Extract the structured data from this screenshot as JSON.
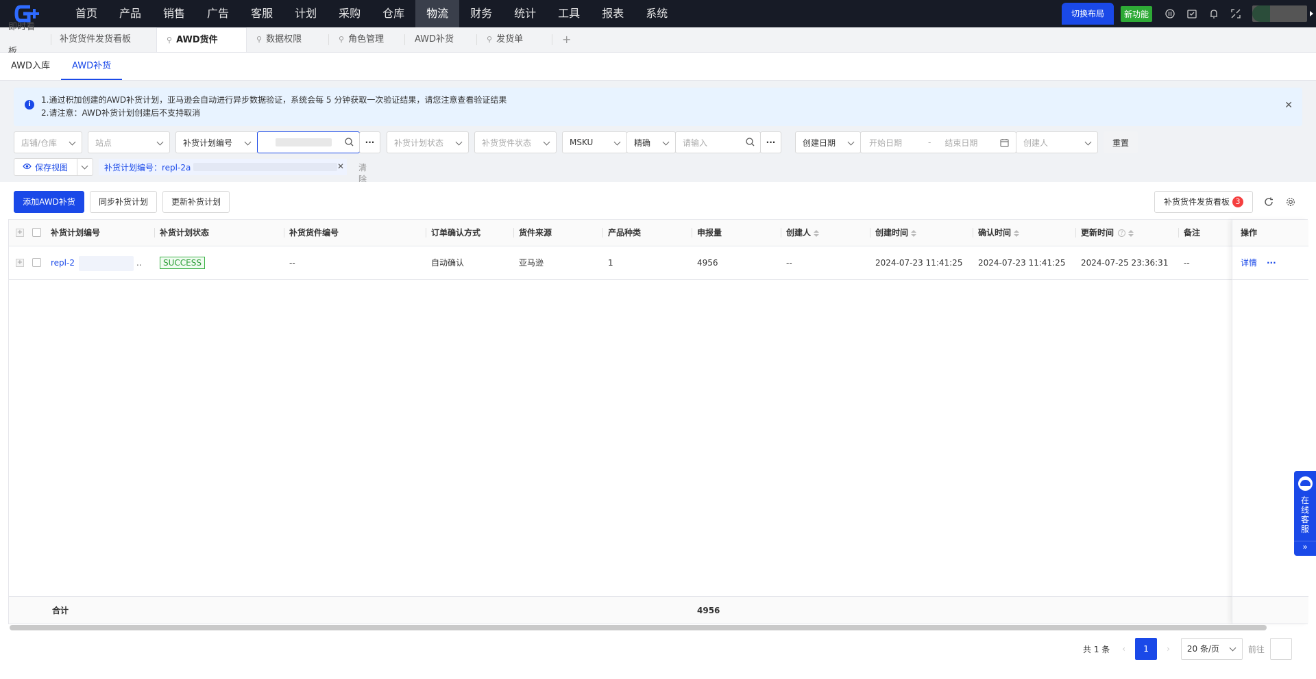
{
  "topnav": {
    "menu": [
      "首页",
      "产品",
      "销售",
      "广告",
      "客服",
      "计划",
      "采购",
      "仓库",
      "物流",
      "财务",
      "统计",
      "工具",
      "报表",
      "系统"
    ],
    "active": "物流",
    "switch_layout": "切换布局",
    "new_feature": "新功能"
  },
  "page_tabs": [
    {
      "label": "即时看板",
      "pinned": false
    },
    {
      "label": "补货货件发货看板",
      "pinned": false
    },
    {
      "label": "AWD货件",
      "pinned": true,
      "active": true
    },
    {
      "label": "数据权限",
      "pinned": true
    },
    {
      "label": "角色管理",
      "pinned": true
    },
    {
      "label": "AWD补货",
      "pinned": false
    },
    {
      "label": "发货单",
      "pinned": true
    }
  ],
  "sub_tabs": [
    "AWD入库",
    "AWD补货"
  ],
  "alert": {
    "line1": "1.通过积加创建的AWD补货计划，亚马逊会自动进行异步数据验证，系统会每 5 分钟获取一次验证结果，请您注意查看验证结果",
    "line2": "2.请注意：AWD补货计划创建后不支持取消"
  },
  "filters": {
    "store": "店铺/仓库",
    "site": "站点",
    "plan_no_type": "补货计划编号",
    "plan_status": "补货计划状态",
    "shipment_status": "补货货件状态",
    "sku_type": "MSKU",
    "match": "精确",
    "search_placeholder": "请输入",
    "date_type": "创建日期",
    "start_date": "开始日期",
    "date_sep": "-",
    "end_date": "结束日期",
    "creator": "创建人",
    "reset": "重置"
  },
  "view": {
    "save_view": "保存视图",
    "chip": "补货计划编号：repl-2a",
    "clear_all": "清除全部"
  },
  "toolbar": {
    "add": "添加AWD补货",
    "sync": "同步补货计划",
    "update": "更新补货计划",
    "board": "补货货件发货看板",
    "board_count": "3"
  },
  "table": {
    "columns": [
      "补货计划编号",
      "补货计划状态",
      "补货货件编号",
      "订单确认方式",
      "货件来源",
      "产品种类",
      "申报量",
      "创建人",
      "创建时间",
      "确认时间",
      "更新时间",
      "备注",
      "操作"
    ],
    "rows": [
      {
        "plan_no": "repl-2",
        "ellipsis": "..",
        "status": "SUCCESS",
        "shipment_no": "--",
        "confirm_method": "自动确认",
        "source": "亚马逊",
        "product_types": "1",
        "quantity": "4956",
        "creator": "--",
        "created": "2024-07-23 11:41:25",
        "confirmed": "2024-07-23 11:41:25",
        "updated": "2024-07-25 23:36:31",
        "remark": "--",
        "detail": "详情",
        "more": "···"
      }
    ],
    "footer_label": "合计",
    "footer_total": "4956"
  },
  "pager": {
    "total": "共 1 条",
    "page": "1",
    "page_size": "20 条/页",
    "goto": "前往"
  },
  "side_service": {
    "label": [
      "在",
      "线",
      "客",
      "服"
    ]
  }
}
